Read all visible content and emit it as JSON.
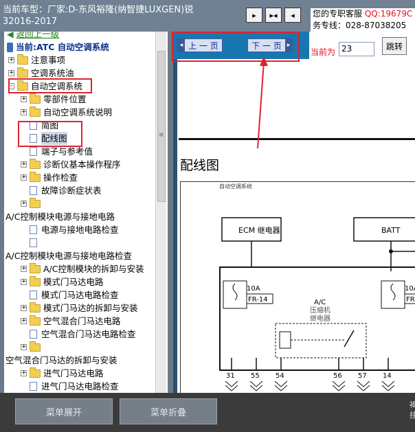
{
  "header": {
    "car_title": "当前车型：厂家:D-东风裕隆(纳智捷LUXGEN)锐 32016-2017",
    "nav_icons": [
      "align-left-icon",
      "split-icon",
      "align-right-icon"
    ],
    "service_line1_prefix": "您的专职客服",
    "service_qq": "QQ:19679C",
    "service_line2": "务专线：028-87038205"
  },
  "tree": {
    "back_link": "返回上一级",
    "current_label": "当前:ATC 自动空调系统",
    "items": [
      {
        "label": "注意事项",
        "type": "folder",
        "expand": "+",
        "level": 1
      },
      {
        "label": "空调系统油",
        "type": "folder",
        "expand": "+",
        "level": 1
      },
      {
        "label": "自动空调系统",
        "type": "folder",
        "expand": "-",
        "level": 1
      },
      {
        "label": "零部件位置",
        "type": "folder",
        "expand": "+",
        "level": 2
      },
      {
        "label": "自动空调系统说明",
        "type": "folder",
        "expand": "+",
        "level": 2
      },
      {
        "label": "简图",
        "type": "doc",
        "level": 2
      },
      {
        "label": "配线图",
        "type": "doc",
        "level": 2,
        "selected": true
      },
      {
        "label": "端子与参考值",
        "type": "doc",
        "level": 2
      },
      {
        "label": "诊断仪基本操作程序",
        "type": "folder",
        "expand": "+",
        "level": 2
      },
      {
        "label": "操作检查",
        "type": "folder",
        "expand": "+",
        "level": 2
      },
      {
        "label": "故障诊断症状表",
        "type": "doc",
        "level": 2
      },
      {
        "label": "",
        "type": "folder",
        "expand": "+",
        "level": 2
      },
      {
        "label": "A/C控制模块电源与接地电路",
        "type": "text",
        "level": 0
      },
      {
        "label": "电源与接地电路检查",
        "type": "doc",
        "level": 2
      },
      {
        "label": "",
        "type": "doc",
        "level": 2
      },
      {
        "label": "A/C控制模块电源与接地电路检查",
        "type": "text",
        "level": 0
      },
      {
        "label": "A/C控制模块的拆卸与安装",
        "type": "folder",
        "expand": "+",
        "level": 2
      },
      {
        "label": "模式门马达电路",
        "type": "folder",
        "expand": "+",
        "level": 2
      },
      {
        "label": "模式门马达电路检查",
        "type": "doc",
        "level": 2
      },
      {
        "label": "模式门马达的拆卸与安装",
        "type": "folder",
        "expand": "+",
        "level": 2
      },
      {
        "label": "空气混合门马达电路",
        "type": "folder",
        "expand": "+",
        "level": 2
      },
      {
        "label": "空气混合门马达电路检查",
        "type": "doc",
        "level": 2
      },
      {
        "label": "",
        "type": "folder",
        "expand": "+",
        "level": 2
      },
      {
        "label": "空气混合门马达的拆卸与安装",
        "type": "text",
        "level": 0
      },
      {
        "label": "进气门马达电路",
        "type": "folder",
        "expand": "+",
        "level": 2
      },
      {
        "label": "进气门马达电路检查",
        "type": "doc",
        "level": 2
      }
    ]
  },
  "pager": {
    "prev_label": "上 一 页",
    "next_label": "下 一 页",
    "current_label": "当前为",
    "current_value": "23",
    "jump_label": "跳转",
    "cut_text": "2"
  },
  "content": {
    "page_title": "配线图",
    "diagram": {
      "header": "自动空调系统",
      "ecm_label": "ECM 继电器",
      "batt_label": "BATT",
      "fuse1_amp": "10A",
      "fuse1_id": "FR-14",
      "fuse2_amp": "10A",
      "fuse2_id": "FR",
      "relay_label1": "A/C",
      "relay_label2": "压缩机",
      "relay_label3": "继电器",
      "pins": [
        "31",
        "55",
        "54",
        "56",
        "57",
        "14"
      ]
    }
  },
  "bottom": {
    "expand_label": "菜单展开",
    "collapse_label": "菜单折叠",
    "cut_text_line1": "褐",
    "cut_text_line2": "挂"
  },
  "colors": {
    "annotation_red": "#e0212e",
    "nav_blue": "#1877b0",
    "qq_red": "#e0101a"
  }
}
